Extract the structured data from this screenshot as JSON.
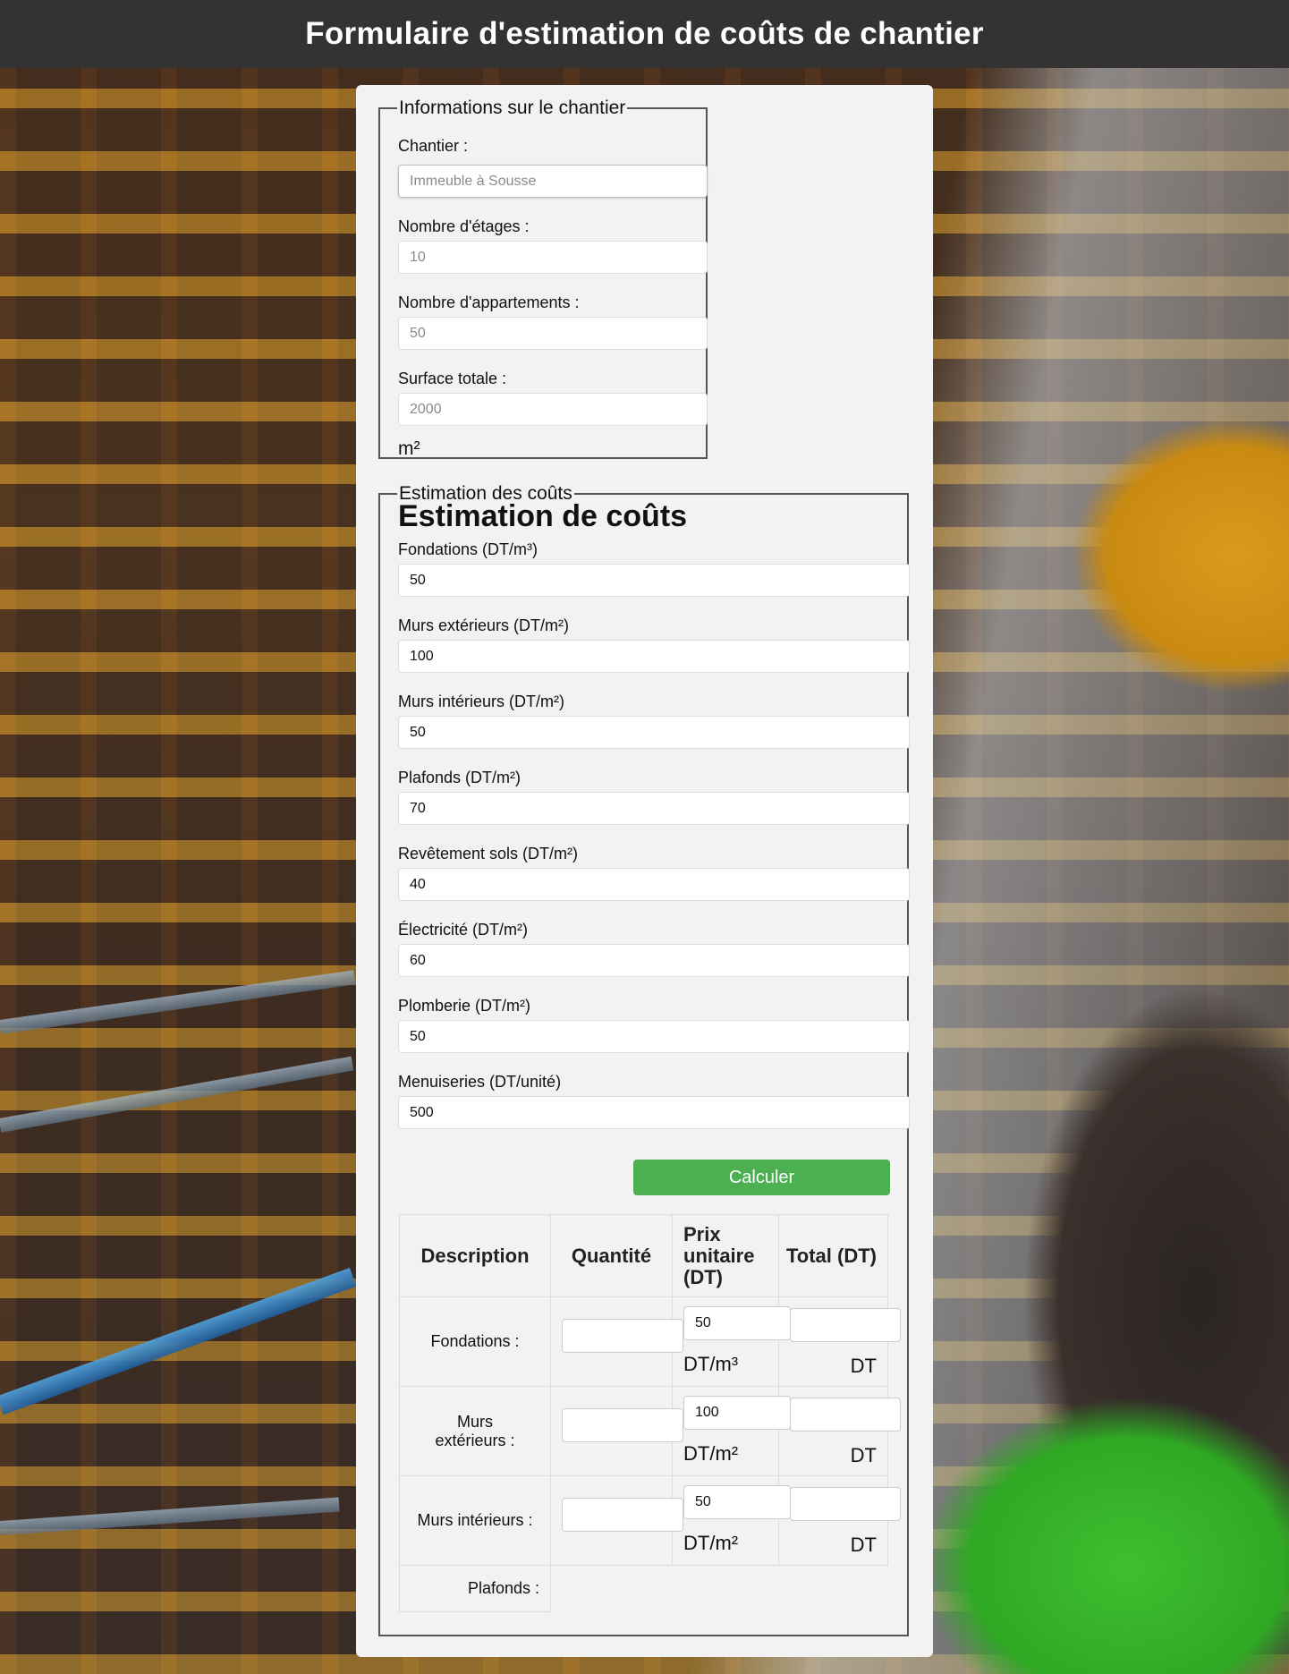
{
  "header": {
    "title": "Formulaire d'estimation de coûts de chantier"
  },
  "info_section": {
    "legend": "Informations sur le chantier",
    "fields": [
      {
        "label": "Chantier :",
        "placeholder": "Immeuble à Sousse"
      },
      {
        "label": "Nombre d'étages :",
        "placeholder": "10"
      },
      {
        "label": "Nombre d'appartements :",
        "placeholder": "50"
      },
      {
        "label": "Surface totale :",
        "placeholder": "2000"
      }
    ],
    "surface_unit": "m²"
  },
  "cost_section": {
    "legend": "Estimation des coûts",
    "title": "Estimation de coûts",
    "fields": [
      {
        "label": "Fondations (DT/m³)",
        "value": "50"
      },
      {
        "label": "Murs extérieurs (DT/m²)",
        "value": "100"
      },
      {
        "label": "Murs intérieurs (DT/m²)",
        "value": "50"
      },
      {
        "label": "Plafonds (DT/m²)",
        "value": "70"
      },
      {
        "label": "Revêtement sols (DT/m²)",
        "value": "40"
      },
      {
        "label": "Électricité (DT/m²)",
        "value": "60"
      },
      {
        "label": "Plomberie (DT/m²)",
        "value": "50"
      },
      {
        "label": "Menuiseries (DT/unité)",
        "value": "500"
      }
    ],
    "calculate_label": "Calculer"
  },
  "table": {
    "headers": {
      "description": "Description",
      "quantity": "Quantité",
      "unit_price": "Prix unitaire (DT)",
      "total": "Total (DT)"
    },
    "rows": [
      {
        "label": "Fondations :",
        "quantity": "",
        "price": "50",
        "price_unit": "DT/m³",
        "total": "",
        "total_unit": "DT"
      },
      {
        "label": "Murs extérieurs :",
        "quantity": "",
        "price": "100",
        "price_unit": "DT/m²",
        "total": "",
        "total_unit": "DT"
      },
      {
        "label": "Murs intérieurs :",
        "quantity": "",
        "price": "50",
        "price_unit": "DT/m²",
        "total": "",
        "total_unit": "DT"
      },
      {
        "label": "Plafonds :"
      }
    ]
  }
}
